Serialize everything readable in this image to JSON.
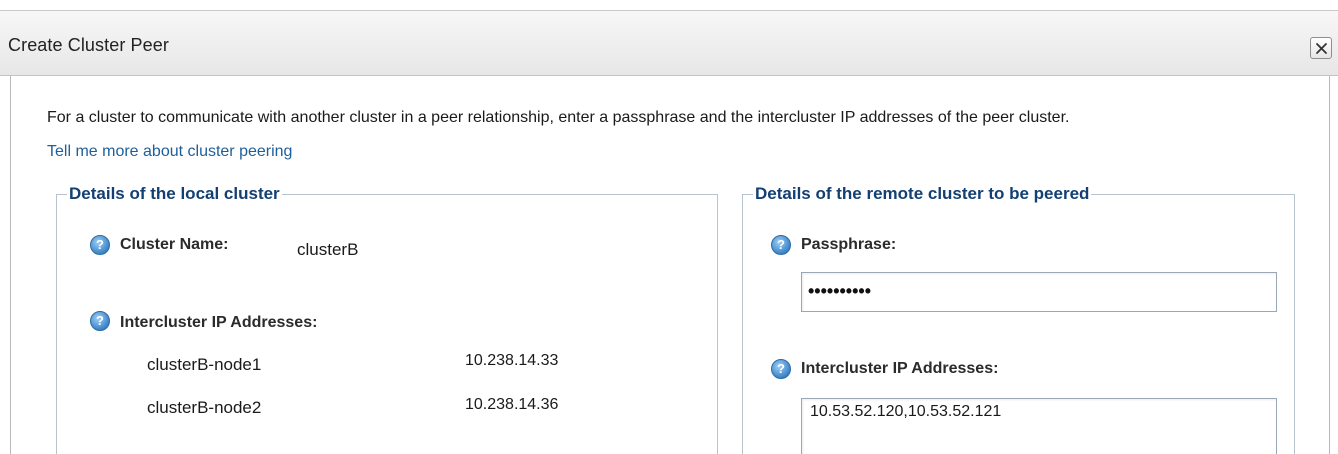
{
  "dialog": {
    "title": "Create Cluster Peer",
    "close_icon": "close-icon"
  },
  "intro": {
    "text": "For a cluster to communicate with another cluster in a peer relationship, enter a passphrase and the intercluster IP addresses of the peer cluster.",
    "link": "Tell me more about cluster peering"
  },
  "local": {
    "legend": "Details of the local cluster",
    "cluster_name_label": "Cluster Name:",
    "cluster_name_value": "clusterB",
    "ip_label": "Intercluster IP Addresses:",
    "nodes": [
      {
        "name": "clusterB-node1",
        "ip": "10.238.14.33"
      },
      {
        "name": "clusterB-node2",
        "ip": "10.238.14.36"
      }
    ]
  },
  "remote": {
    "legend": "Details of the remote cluster to be peered",
    "passphrase_label": "Passphrase:",
    "passphrase_value": "••••••••••",
    "ip_label": "Intercluster IP Addresses:",
    "ip_value": "10.53.52.120,10.53.52.121"
  },
  "help_icon_glyph": "?",
  "colors": {
    "legend": "#133f73",
    "link": "#1d5f9a",
    "help_icon": "#3c84c8"
  }
}
